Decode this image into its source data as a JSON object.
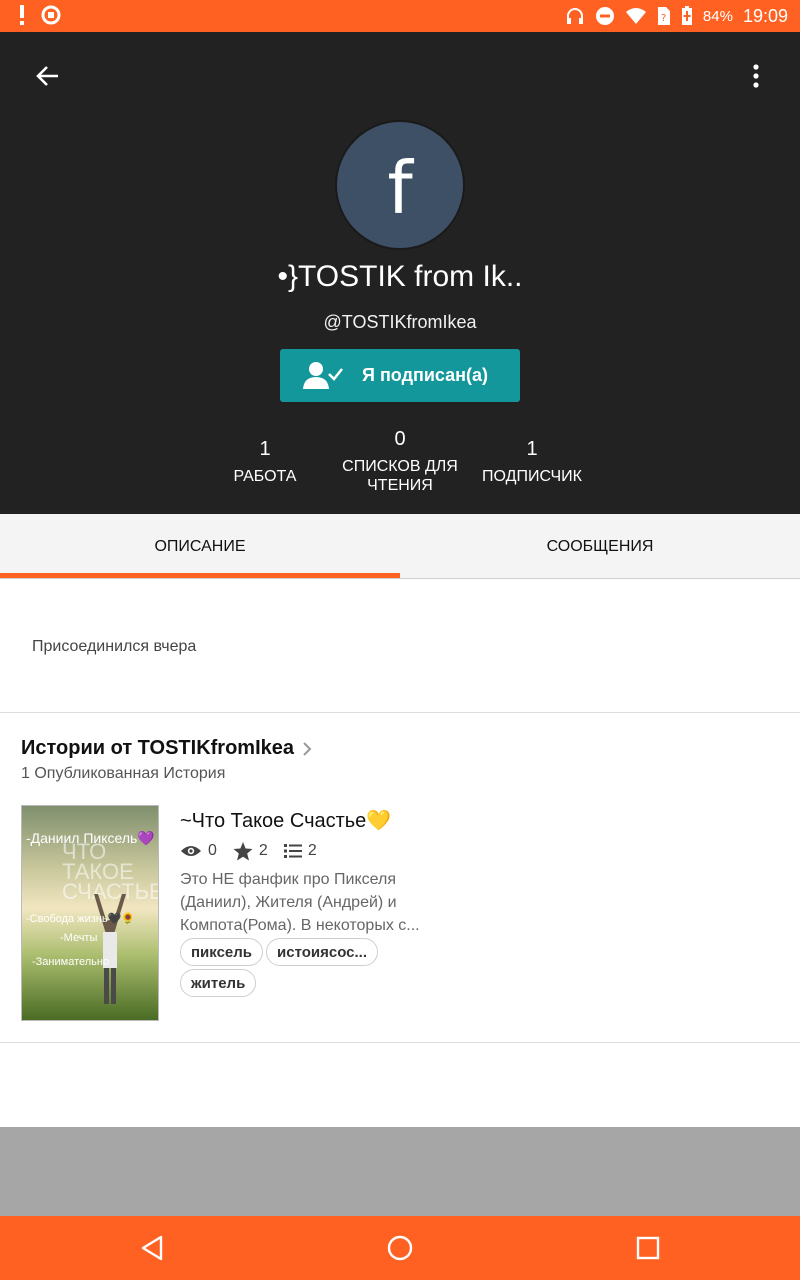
{
  "status_bar": {
    "battery": "84%",
    "time": "19:09",
    "icons": [
      "alert-icon",
      "sync-icon",
      "headphones-icon",
      "dnd-icon",
      "wifi-icon",
      "sim-icon",
      "battery-icon"
    ],
    "color": "#ff6122"
  },
  "profile": {
    "avatar_letter": "f",
    "display_name": "•}TOSTIK from Ik..",
    "handle": "@TOSTIKfromIkea",
    "follow_label": "Я подписан(а)",
    "follow_color": "#14979b"
  },
  "stats": [
    {
      "value": "1",
      "label": "РАБОТА"
    },
    {
      "value": "0",
      "label": "СПИСКОВ ДЛЯ ЧТЕНИЯ"
    },
    {
      "value": "1",
      "label": "ПОДПИСЧИК"
    }
  ],
  "tabs": {
    "description": "ОПИСАНИЕ",
    "messages": "СООБЩЕНИЯ",
    "active": "description"
  },
  "about": {
    "joined": "Присоединился вчера"
  },
  "stories": {
    "title": "Истории от TOSTIKfromIkea",
    "count": "1 Опубликованная История",
    "items": [
      {
        "title": "~Что Такое Счастье💛",
        "reads": "0",
        "votes": "2",
        "parts": "2",
        "description": "Это НЕ фанфик про Пикселя (Даниил), Жителя (Андрей) и Компота(Рома). В некоторых с...",
        "tags": [
          "пиксель",
          "истоиясос...",
          "житель"
        ],
        "cover": {
          "line1": "-Даниил Пиксель💜",
          "line2": "ЧТО ТАКОЕ СЧАСТЬЕ",
          "line3": "-Свобода жизнь🖤🌻",
          "line4": "-Мечты",
          "line5": "-Занимательно"
        }
      }
    ]
  },
  "nav": {
    "back": "back-icon",
    "home": "home-icon",
    "recents": "recents-icon"
  }
}
